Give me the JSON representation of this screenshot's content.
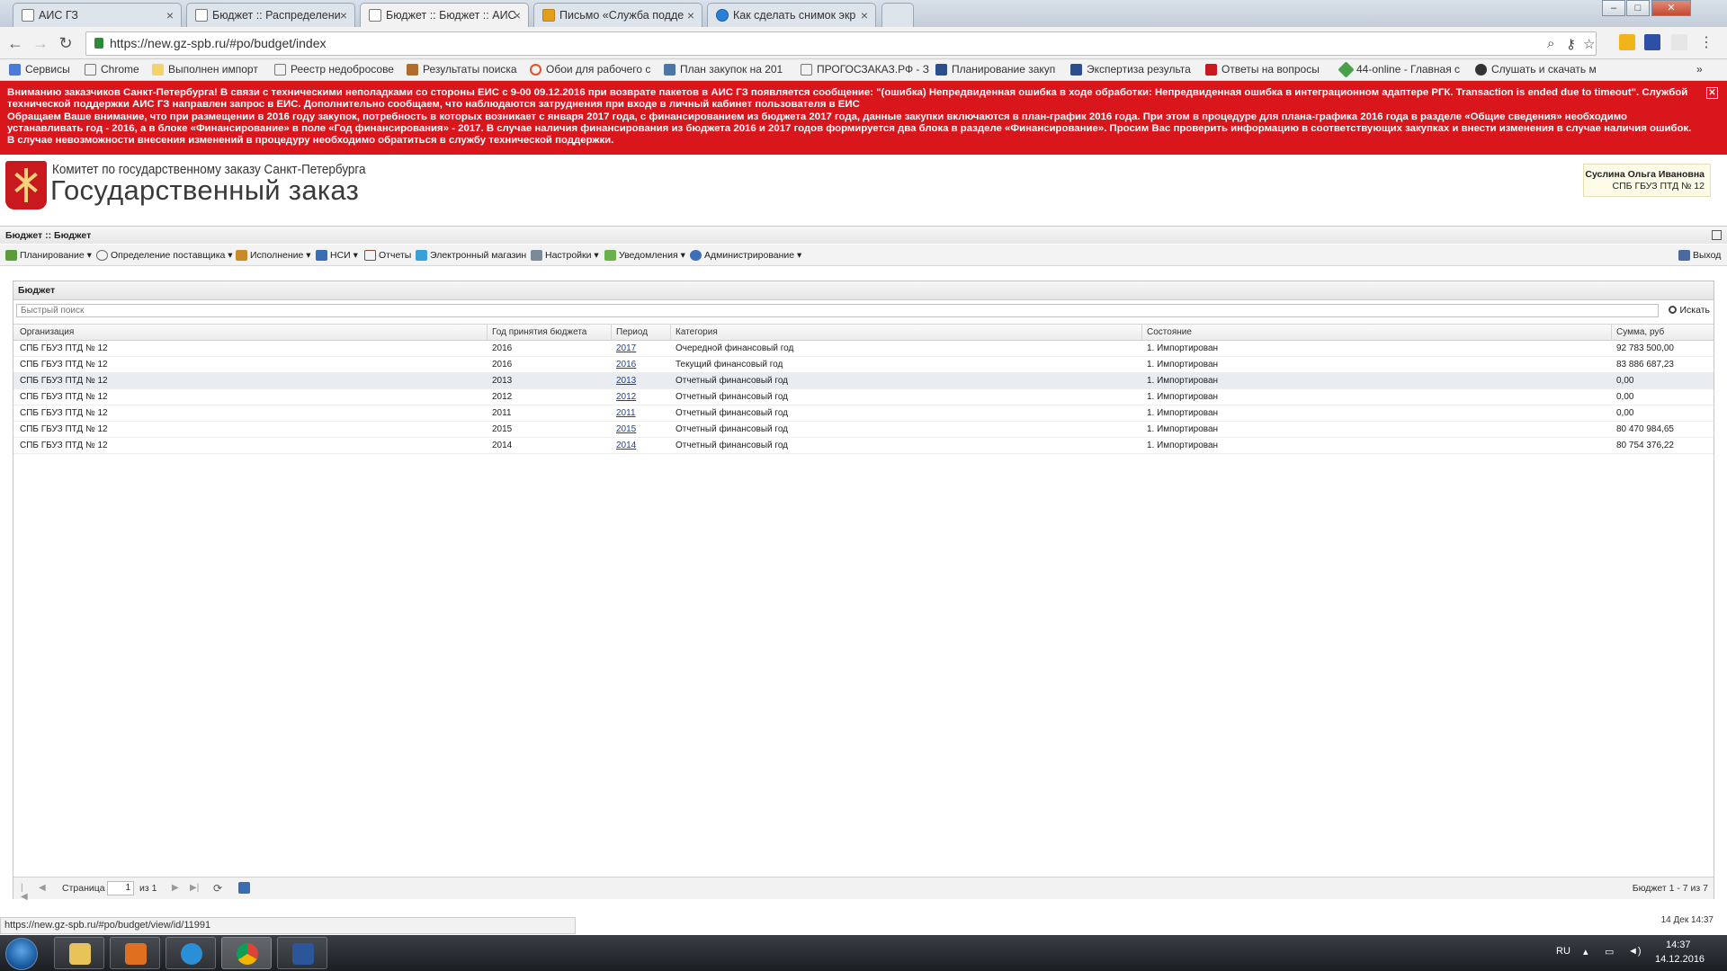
{
  "browser": {
    "tabs": [
      {
        "title": "АИС ГЗ",
        "active": false
      },
      {
        "title": "Бюджет :: Распределени",
        "active": false
      },
      {
        "title": "Бюджет :: Бюджет :: АИС",
        "active": true
      },
      {
        "title": "Письмо «Служба подде",
        "active": false
      },
      {
        "title": "Как сделать снимок экр",
        "active": false
      }
    ],
    "url": "https://new.gz-spb.ru/#po/budget/index",
    "bookmarks": [
      "Сервисы",
      "Chrome",
      "Выполнен импорт",
      "Реестр недобросове",
      "Результаты поиска",
      "Обои для рабочего с",
      "План закупок на 201",
      "ПРОГОСЗАКАЗ.РФ - З",
      "Планирование закуп",
      "Экспертиза результа",
      "Ответы на вопросы",
      "44-online - Главная с",
      "Слушать и скачать м"
    ],
    "status_url": "https://new.gz-spb.ru/#po/budget/view/id/11991"
  },
  "alert": {
    "lines": [
      "Вниманию заказчиков Санкт-Петербурга! В связи с техническими неполадками со стороны ЕИС с 9-00 09.12.2016 при возврате пакетов в АИС ГЗ появляется сообщение: \"(ошибка) Непредвиденная ошибка в ходе обработки: Непредвиденная ошибка в интеграционном адаптере РГК. Transaction is ended due to timeout\". Службой технической поддержки АИС ГЗ направлен запрос в ЕИС. Дополнительно сообщаем, что наблюдаются затруднения при входе в личный кабинет пользователя в ЕИС",
      "Обращаем Ваше внимание, что при размещении в 2016 году закупок, потребность в которых возникает с января 2017 года, с финансированием из бюджета 2017 года, данные закупки включаются в план-график 2016 года. При этом в процедуре для плана-графика 2016 года в разделе «Общие сведения» необходимо устанавливать год - 2016, а в блоке «Финансирование» в поле «Год финансирования» - 2017. В случае наличия финансирования из бюджета 2016 и 2017 годов формируется два блока в разделе «Финансирование». Просим Вас проверить информацию в соответствующих закупках и внести изменения в случае наличия ошибок. В случае невозможности внесения изменений в процедуру необходимо обратиться в службу технической поддержки."
    ]
  },
  "header": {
    "org": "Комитет по государственному заказу Санкт-Петербурга",
    "product": "Государственный заказ",
    "user_name": "Суслина Ольга Ивановна",
    "user_org": "СПБ ГБУЗ ПТД № 12"
  },
  "breadcrumb": "Бюджет :: Бюджет",
  "menu": {
    "items": [
      "Планирование",
      "Определение поставщика",
      "Исполнение",
      "НСИ",
      "Отчеты",
      "Электронный магазин",
      "Настройки",
      "Уведомления",
      "Администрирование"
    ],
    "logout": "Выход"
  },
  "panel": {
    "title": "Бюджет",
    "search_placeholder": "Быстрый поиск",
    "search_button": "Искать",
    "columns": [
      "Организация",
      "Год принятия бюджета",
      "Период",
      "Категория",
      "Состояние",
      "Сумма, руб"
    ],
    "rows": [
      {
        "org": "СПБ ГБУЗ ПТД № 12",
        "year": "2016",
        "period": "2017",
        "category": "Очередной финансовый год",
        "state": "1. Импортирован",
        "sum": "92 783 500,00"
      },
      {
        "org": "СПБ ГБУЗ ПТД № 12",
        "year": "2016",
        "period": "2016",
        "category": "Текущий финансовый год",
        "state": "1. Импортирован",
        "sum": "83 886 687,23"
      },
      {
        "org": "СПБ ГБУЗ ПТД № 12",
        "year": "2013",
        "period": "2013",
        "category": "Отчетный финансовый год",
        "state": "1. Импортирован",
        "sum": "0,00"
      },
      {
        "org": "СПБ ГБУЗ ПТД № 12",
        "year": "2012",
        "period": "2012",
        "category": "Отчетный финансовый год",
        "state": "1. Импортирован",
        "sum": "0,00"
      },
      {
        "org": "СПБ ГБУЗ ПТД № 12",
        "year": "2011",
        "period": "2011",
        "category": "Отчетный финансовый год",
        "state": "1. Импортирован",
        "sum": "0,00"
      },
      {
        "org": "СПБ ГБУЗ ПТД № 12",
        "year": "2015",
        "period": "2015",
        "category": "Отчетный финансовый год",
        "state": "1. Импортирован",
        "sum": "80 470 984,65"
      },
      {
        "org": "СПБ ГБУЗ ПТД № 12",
        "year": "2014",
        "period": "2014",
        "category": "Отчетный финансовый год",
        "state": "1. Импортирован",
        "sum": "80 754 376,22"
      }
    ],
    "pager": {
      "page_label": "Страница",
      "page": "1",
      "of_label": "из 1",
      "summary": "Бюджет 1 - 7 из 7"
    }
  },
  "page_date": "14 Дек 14:37",
  "taskbar": {
    "lang": "RU",
    "time": "14:37",
    "date": "14.12.2016"
  },
  "colors": {
    "alert_bg": "#d9161b",
    "link": "#1a40a8"
  }
}
